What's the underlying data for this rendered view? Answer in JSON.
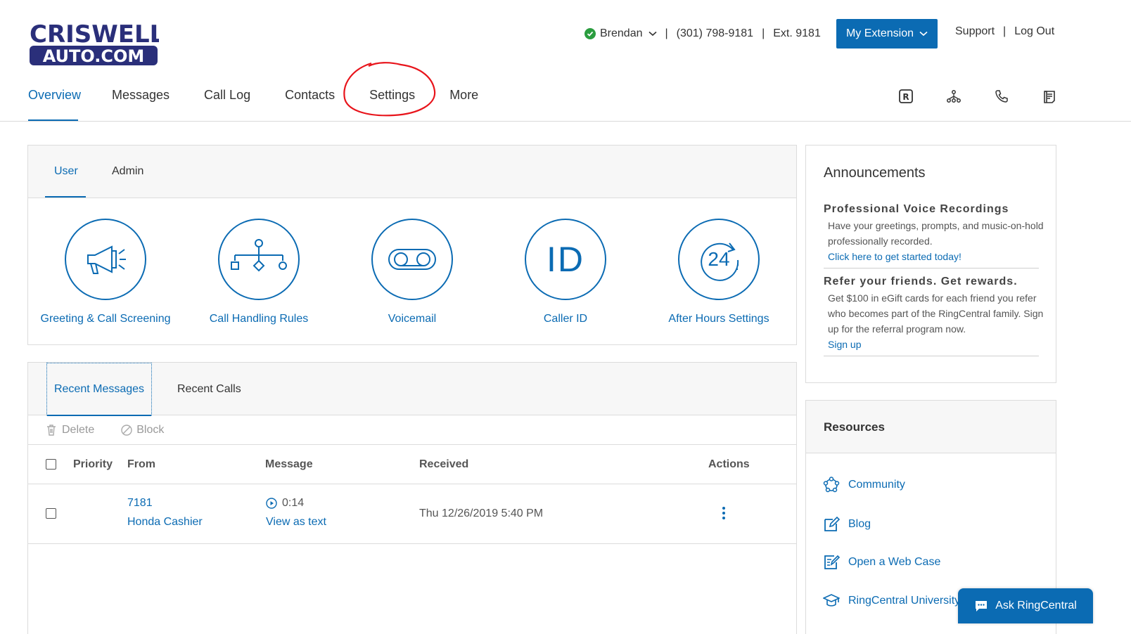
{
  "brand": {
    "logo_line1": "CRISWELL",
    "logo_line2": "AUTO.COM",
    "logo_color": "#2a2f7a"
  },
  "header": {
    "user_name": "Brendan",
    "phone": "(301) 798-9181",
    "extension": "Ext. 9181",
    "my_extension_label": "My Extension",
    "support_label": "Support",
    "logout_label": "Log Out",
    "separator": "|"
  },
  "nav": {
    "items": [
      {
        "label": "Overview"
      },
      {
        "label": "Messages"
      },
      {
        "label": "Call Log"
      },
      {
        "label": "Contacts"
      },
      {
        "label": "Settings"
      },
      {
        "label": "More"
      }
    ],
    "active": "Overview",
    "annotation_color": "#e8141b"
  },
  "tools": [
    "rc-app-icon",
    "org-chart-icon",
    "phone-icon",
    "fax-icon"
  ],
  "settings": {
    "tabs": [
      {
        "label": "User"
      },
      {
        "label": "Admin"
      }
    ],
    "features": [
      {
        "label": "Greeting & Call Screening",
        "icon": "megaphone-icon"
      },
      {
        "label": "Call Handling Rules",
        "icon": "call-flow-icon"
      },
      {
        "label": "Voicemail",
        "icon": "voicemail-icon"
      },
      {
        "label": "Caller ID",
        "icon": "caller-id-icon",
        "icon_text": "ID"
      },
      {
        "label": "After Hours Settings",
        "icon": "after-hours-icon",
        "icon_text": "24"
      }
    ]
  },
  "messages": {
    "tabs": [
      {
        "label": "Recent Messages"
      },
      {
        "label": "Recent Calls"
      }
    ],
    "toolbar": {
      "delete": "Delete",
      "block": "Block"
    },
    "columns": {
      "priority": "Priority",
      "from": "From",
      "message": "Message",
      "received": "Received",
      "actions": "Actions"
    },
    "rows": [
      {
        "from_number": "7181",
        "from_name": "Honda Cashier",
        "duration": "0:14",
        "view_text": "View as text",
        "received": "Thu 12/26/2019 5:40 PM"
      }
    ]
  },
  "announcements": {
    "title": "Announcements",
    "items": [
      {
        "heading": "Professional Voice Recordings",
        "body": "Have your greetings, prompts, and music-on-hold professionally recorded.",
        "link": "Click here to get started today!"
      },
      {
        "heading": "Refer your friends. Get rewards.",
        "body": "Get $100 in eGift cards for each friend you refer who becomes part of the RingCentral family. Sign up for the referral program now.",
        "link": "Sign up"
      }
    ]
  },
  "resources": {
    "title": "Resources",
    "items": [
      {
        "label": "Community",
        "icon": "community-icon"
      },
      {
        "label": "Blog",
        "icon": "blog-icon"
      },
      {
        "label": "Open a Web Case",
        "icon": "web-case-icon"
      },
      {
        "label": "RingCentral University",
        "icon": "graduation-cap-icon"
      }
    ]
  },
  "chat": {
    "label": "Ask RingCentral"
  },
  "colors": {
    "accent": "#0b6bb3",
    "status_green": "#2a9d3f",
    "panel_bg": "#f7f7f7",
    "border": "#dcdcdc"
  }
}
